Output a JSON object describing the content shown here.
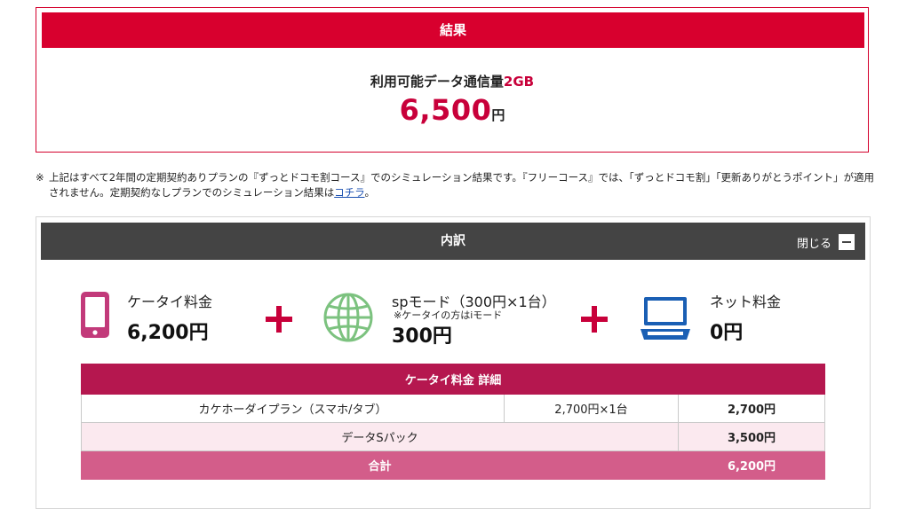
{
  "result": {
    "header": "結果",
    "data_label": "利用可能データ通信量",
    "data_amount": "2GB",
    "price": "6,500",
    "price_unit": "円"
  },
  "note": {
    "mark": "※",
    "text": "上記はすべて2年間の定期契約ありプランの『ずっとドコモ割コース』でのシミュレーション結果です。『フリーコース』では、「ずっとドコモ割」「更新ありがとうポイント」が適用されません。定期契約なしプランでのシミュレーション結果は",
    "link": "コチラ",
    "end": "。"
  },
  "breakdown": {
    "title": "内訳",
    "close_label": "閉じる",
    "items": [
      {
        "label": "ケータイ料金",
        "sub": "",
        "amount": "6,200円",
        "icon": "smartphone-icon"
      },
      {
        "label": "spモード（300円×1台）",
        "sub": "※ケータイの方はiモード",
        "amount": "300円",
        "icon": "globe-icon"
      },
      {
        "label": "ネット料金",
        "sub": "",
        "amount": "0円",
        "icon": "laptop-icon"
      }
    ],
    "table": {
      "title": "ケータイ料金 詳細",
      "rows": [
        {
          "name": "カケホーダイプラン（スマホ/タブ）",
          "unit": "2,700円×1台",
          "price": "2,700円"
        },
        {
          "name": "データSパック",
          "unit": "",
          "price": "3,500円"
        }
      ],
      "total_label": "合計",
      "total_price": "6,200円"
    }
  },
  "colors": {
    "accent_red": "#d8002e",
    "table_header": "#b5174f",
    "total_row": "#d35d8a",
    "globe_green": "#7cc27f",
    "laptop_blue": "#1a5fb4"
  }
}
